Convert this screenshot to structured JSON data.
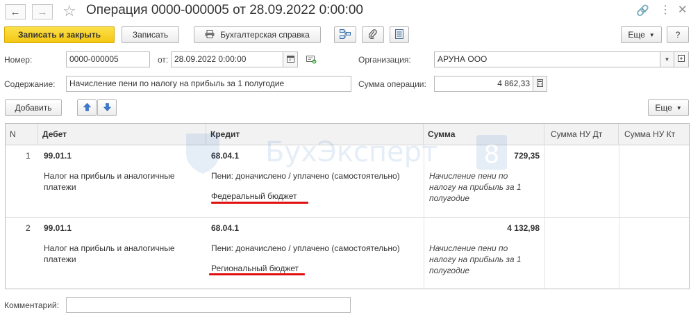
{
  "window": {
    "title": "Операция 0000-000005 от 28.09.2022 0:00:00",
    "back_icon": "arrow-left-icon",
    "forward_icon": "arrow-right-icon",
    "favorite_icon": "star-icon",
    "link_icon": "link-icon",
    "more_icon": "more-vertical-icon",
    "close_icon": "close-icon"
  },
  "toolbar": {
    "save_close_label": "Записать и закрыть",
    "save_label": "Записать",
    "report_label": "Бухгалтерская справка",
    "more_label": "Еще",
    "help_label": "?"
  },
  "form": {
    "number_label": "Номер:",
    "number_value": "0000-000005",
    "date_label": "от:",
    "date_value": "28.09.2022  0:00:00",
    "org_label": "Организация:",
    "org_value": "АРУНА ООО",
    "content_label": "Содержание:",
    "content_value": "Начисление пени по налогу на прибыль за 1 полугодие",
    "sum_label": "Сумма операции:",
    "sum_value": "4 862,33"
  },
  "table_toolbar": {
    "add_label": "Добавить",
    "more_label": "Еще"
  },
  "table": {
    "columns": [
      "N",
      "Дебет",
      "Кредит",
      "Сумма",
      "Сумма НУ Дт",
      "Сумма НУ Кт"
    ],
    "rows": [
      {
        "n": "1",
        "debit_account": "99.01.1",
        "debit_sub_1": "Налог на прибыль и аналогичные",
        "debit_sub_2": "платежи",
        "credit_account": "68.04.1",
        "credit_sub_1": "Пени: доначислено / уплачено (самостоятельно)",
        "credit_sub_2": "Федеральный бюджет",
        "amount": "729,35",
        "content_1": "Начисление пени по",
        "content_2": "налогу на прибыль за 1",
        "content_3": "полугодие"
      },
      {
        "n": "2",
        "debit_account": "99.01.1",
        "debit_sub_1": "Налог на прибыль и аналогичные",
        "debit_sub_2": "платежи",
        "credit_account": "68.04.1",
        "credit_sub_1": "Пени: доначислено / уплачено (самостоятельно)",
        "credit_sub_2": "Региональный бюджет",
        "amount": "4 132,98",
        "content_1": "Начисление пени по",
        "content_2": "налогу на прибыль за 1",
        "content_3": "полугодие"
      }
    ]
  },
  "comment": {
    "label": "Комментарий:",
    "value": ""
  },
  "watermark": {
    "text": "БухЭксперт",
    "badge": "8"
  },
  "colors": {
    "primary_button": "#f4c713",
    "highlight_underline": "#e01010",
    "header_bg": "#f2f2f2",
    "arrow_blue": "#3a7bd5"
  }
}
